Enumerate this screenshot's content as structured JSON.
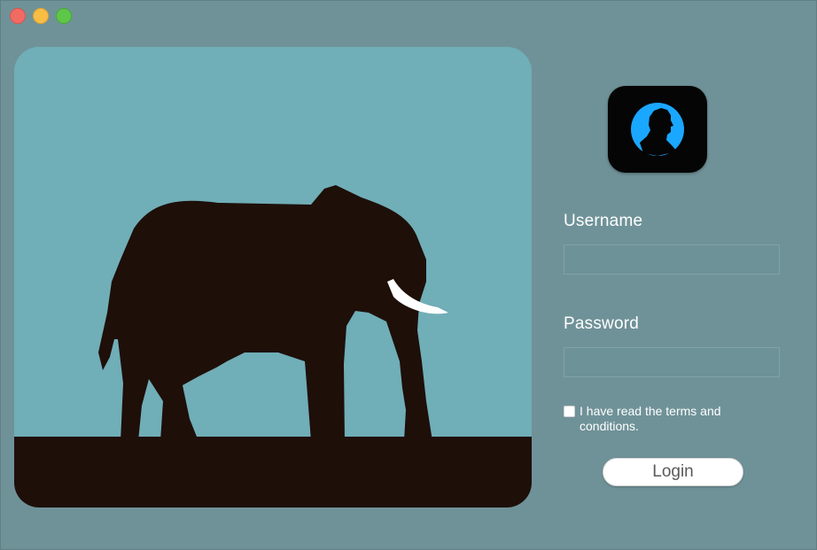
{
  "window": {
    "controls": [
      "close",
      "minimize",
      "zoom"
    ]
  },
  "hero": {
    "icon": "elephant-silhouette",
    "colors": {
      "sky": "#70aeb8",
      "silhouette": "#1e0f09",
      "tusk": "#ffffff"
    }
  },
  "app_icon": {
    "icon": "user-profile-icon",
    "colors": {
      "background": "#050505",
      "accent": "#1aa7ff"
    }
  },
  "form": {
    "username_label": "Username",
    "username_value": "",
    "password_label": "Password",
    "password_value": "",
    "terms_text": "I have read the terms and conditions.",
    "terms_checked": false,
    "login_label": "Login"
  }
}
